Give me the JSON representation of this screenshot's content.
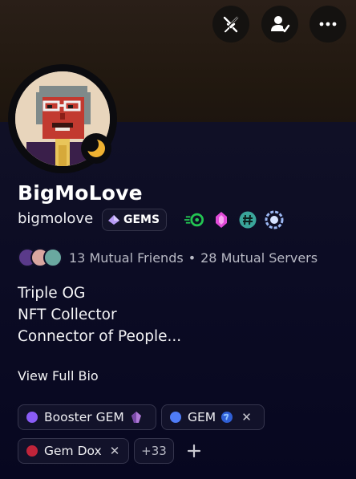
{
  "profile": {
    "display_name": "BigMoLove",
    "username": "bigmolove",
    "gems_tag": "GEMS",
    "mutual_friends": "13 Mutual Friends",
    "mutual_servers": "28 Mutual Servers",
    "bio_lines": [
      "Triple OG",
      "NFT Collector",
      "Connector of People..."
    ],
    "view_full_bio": "View Full Bio",
    "status": "idle"
  },
  "header_buttons": [
    "swords-icon",
    "add-friend-icon",
    "more-icon"
  ],
  "roles": [
    {
      "label": "Booster GEM",
      "color": "#8a5cf6",
      "icon": "crystal-icon"
    },
    {
      "label": "GEM",
      "color": "#4f7cf7",
      "icon": "globe-icon"
    },
    {
      "label": "Gem Dox",
      "color": "#c0243a"
    }
  ],
  "more_roles": "+33",
  "colors": {
    "accent_green": "#23c552",
    "accent_pink": "#e14bd8",
    "accent_teal": "#3aa59a"
  }
}
